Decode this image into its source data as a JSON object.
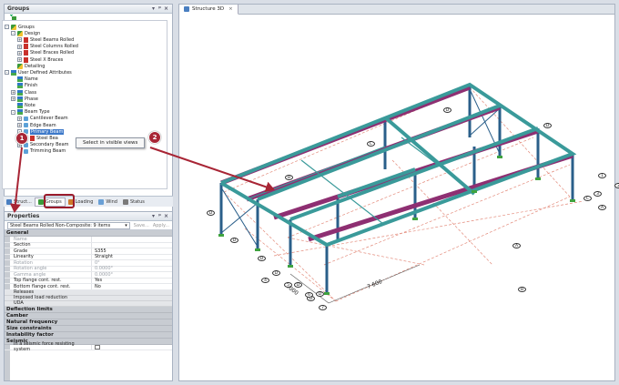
{
  "groups_panel": {
    "title": "Groups",
    "controls": [
      "▾",
      "ᵖ",
      "×"
    ],
    "tree": [
      {
        "label": "Groups",
        "level": 0,
        "exp": "-",
        "icon": "grp"
      },
      {
        "label": "Design",
        "level": 1,
        "exp": "-",
        "icon": "grp"
      },
      {
        "label": "Steel Beams Rolled",
        "level": 2,
        "exp": "+",
        "icon": "beam"
      },
      {
        "label": "Steel Columns Rolled",
        "level": 2,
        "exp": "+",
        "icon": "beam"
      },
      {
        "label": "Steel Braces Rolled",
        "level": 2,
        "exp": "+",
        "icon": "beam"
      },
      {
        "label": "Steel X Braces",
        "level": 2,
        "exp": "+",
        "icon": "beam"
      },
      {
        "label": "Detailing",
        "level": 1,
        "exp": "",
        "icon": "grp"
      },
      {
        "label": "User Defined Attributes",
        "level": 0,
        "exp": "-",
        "icon": "attr"
      },
      {
        "label": "Name",
        "level": 1,
        "exp": "",
        "icon": "attr"
      },
      {
        "label": "Finish",
        "level": 1,
        "exp": "",
        "icon": "attr"
      },
      {
        "label": "Class",
        "level": 1,
        "exp": "+",
        "icon": "attr"
      },
      {
        "label": "Phase",
        "level": 1,
        "exp": "+",
        "icon": "attr"
      },
      {
        "label": "Note",
        "level": 1,
        "exp": "",
        "icon": "attr"
      },
      {
        "label": "Beam Type",
        "level": 1,
        "exp": "-",
        "icon": "attr"
      },
      {
        "label": "Cantilever Beam",
        "level": 2,
        "exp": "+",
        "icon": "item"
      },
      {
        "label": "Edge Beam",
        "level": 2,
        "exp": "+",
        "icon": "item"
      },
      {
        "label": "Primary Beam",
        "level": 2,
        "exp": "-",
        "icon": "item",
        "selected": true
      },
      {
        "label": "Steel Bea",
        "level": 3,
        "exp": "",
        "icon": "beam"
      },
      {
        "label": "Secondary Beam",
        "level": 2,
        "exp": "+",
        "icon": "item"
      },
      {
        "label": "Trimming Beam",
        "level": 2,
        "exp": "",
        "icon": "item"
      }
    ],
    "context_menu": {
      "item": "Select in visible views"
    }
  },
  "bottom_tabs": [
    {
      "label": "Struct...",
      "color": "#4a7fc1"
    },
    {
      "label": "Groups",
      "color": "#3b9a3b",
      "active": true
    },
    {
      "label": "Loading",
      "color": "#d07a2a"
    },
    {
      "label": "Wind",
      "color": "#6aa0d6"
    },
    {
      "label": "Status",
      "color": "#7a7a7a"
    }
  ],
  "properties": {
    "title": "Properties",
    "selector": "Steel Beams Rolled Non-Composite: 9 items",
    "save_label": "Save...",
    "apply_label": "Apply...",
    "rows": [
      {
        "kind": "section",
        "label": "General"
      },
      {
        "kind": "row",
        "key": "Name",
        "value": "",
        "dim": true,
        "plus": true
      },
      {
        "kind": "row",
        "key": "Section",
        "value": ""
      },
      {
        "kind": "row",
        "key": "Grade",
        "value": "S355"
      },
      {
        "kind": "row",
        "key": "Linearity",
        "value": "Straight"
      },
      {
        "kind": "row",
        "key": "Rotation",
        "value": "0°",
        "dim": true
      },
      {
        "kind": "row",
        "key": "Rotation angle",
        "value": "0.0000°",
        "dim": true
      },
      {
        "kind": "row",
        "key": "Gamma angle",
        "value": "0.0000°",
        "dim": true
      },
      {
        "kind": "row",
        "key": "Top flange cont. rest.",
        "value": "Yes"
      },
      {
        "kind": "row",
        "key": "Bottom flange cont. rest.",
        "value": "No"
      },
      {
        "kind": "sub",
        "label": "Releases"
      },
      {
        "kind": "sub",
        "label": "Imposed load reduction"
      },
      {
        "kind": "sub",
        "label": "UDA"
      },
      {
        "kind": "section",
        "label": "Deflection limits"
      },
      {
        "kind": "section",
        "label": "Camber"
      },
      {
        "kind": "section",
        "label": "Natural frequency"
      },
      {
        "kind": "section",
        "label": "Size constraints"
      },
      {
        "kind": "section",
        "label": "Instability factor"
      },
      {
        "kind": "section",
        "label": "Seismic"
      },
      {
        "kind": "check",
        "key": "In a seismic force resisting system"
      }
    ]
  },
  "viewport": {
    "tab_label": "Structure 3D",
    "tab_close": "×",
    "dimension_1": "4000",
    "dimension_2": "7 600",
    "grid_labels_numbers": [
      "1",
      "2",
      "3",
      "4",
      "5",
      "6",
      "7"
    ],
    "grid_labels_letters": [
      "A",
      "B",
      "C",
      "D"
    ]
  },
  "callouts": [
    "1",
    "2"
  ],
  "stray_mark": "7",
  "colors": {
    "accent": "#a82535",
    "primary_beam": "#8e2f72",
    "frame": "#3a9a9a",
    "column": "#2a5f8a",
    "support": "#3fa33f",
    "grid_dash": "#e38a7a"
  }
}
